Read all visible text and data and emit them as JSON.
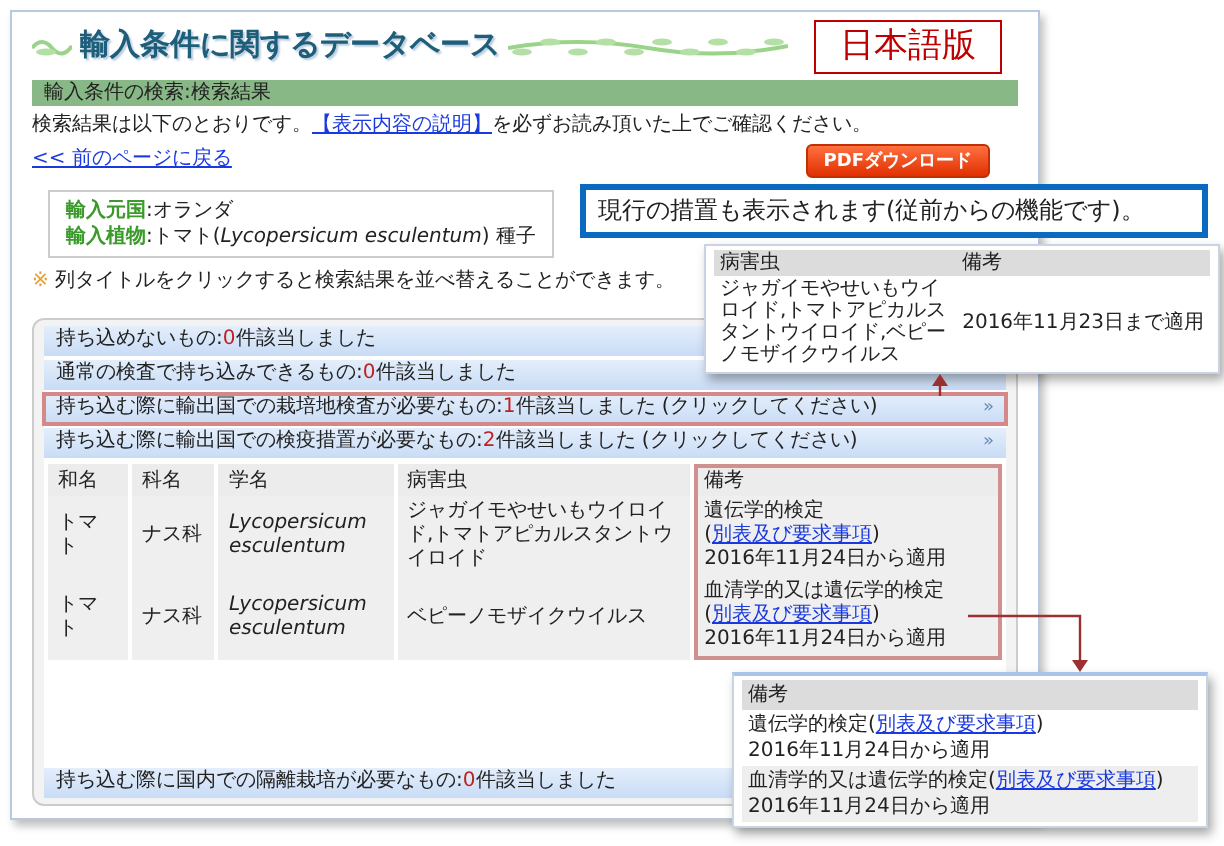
{
  "header": {
    "title": "輸入条件に関するデータベース",
    "badge": "日本語版"
  },
  "breadcrumb": "輸入条件の検索:検索結果",
  "intro": {
    "before": "検索結果は以下のとおりです。",
    "link": "【表示内容の説明】",
    "after": "を必ずお読み頂いた上でご確認ください。"
  },
  "back_link": "<< 前のページに戻る",
  "pdf_button": "PDFダウンロード",
  "summary": [
    {
      "label": "輸入元国",
      "value": ":オランダ"
    },
    {
      "label": "輸入植物",
      "value": ":トマト(*Lycopersicum esculentum*) 種子"
    }
  ],
  "note": {
    "mark": "※",
    "text": "列タイトルをクリックすると検索結果を並べ替えることができます。"
  },
  "categories": [
    {
      "label": "持ち込めないもの:",
      "count": "0",
      "suffix": "件該当しました",
      "highlighted": false
    },
    {
      "label": "通常の検査で持ち込みできるもの:",
      "count": "0",
      "suffix": "件該当しました",
      "highlighted": false
    },
    {
      "label": "持ち込む際に輸出国での栽培地検査が必要なもの:",
      "count": "1",
      "suffix": "件該当しました (クリックしてください)",
      "highlighted": true,
      "icon": "»"
    },
    {
      "label": "持ち込む際に輸出国での検疫措置が必要なもの:",
      "count": "2",
      "suffix": "件該当しました (クリックしてください)",
      "highlighted": false,
      "icon": "»",
      "table": {
        "columns": [
          {
            "label": "和名",
            "highlighted": false
          },
          {
            "label": "科名",
            "highlighted": false
          },
          {
            "label": "学名",
            "highlighted": false
          },
          {
            "label": "病害虫",
            "highlighted": false
          },
          {
            "label": "備考",
            "highlighted": true
          }
        ],
        "rows": [
          {
            "cells": [
              "トマト",
              "ナス科",
              "*Lycopersicum esculentum*",
              "ジャガイモやせいもウイロイド,トマトアピカルスタントウイロイド"
            ],
            "remarks": [
              {
                "text": "遺伝学的検定(",
                "link": "別表及び要求事項",
                "after": ")"
              },
              {
                "text": "2016年11月24日から適用"
              }
            ]
          },
          {
            "cells": [
              "トマト",
              "ナス科",
              "*Lycopersicum esculentum*",
              "ベピーノモザイクウイルス"
            ],
            "remarks": [
              {
                "text": "血清学的又は遺伝学的検定(",
                "link": "別表及び要求事項",
                "after": ")"
              },
              {
                "text": "2016年11月24日から適用"
              }
            ]
          }
        ]
      }
    },
    {
      "label": "持ち込む際に国内での隔離栽培が必要なもの:",
      "count": "0",
      "suffix": "件該当しました",
      "highlighted": false
    }
  ],
  "callout_current": {
    "text": "現行の措置も表示されます(従前からの機能です)。",
    "columns": [
      "病害虫",
      "備考"
    ],
    "row": [
      "ジャガイモやせいもウイロイド,トマトアピカルスタントウイロイド,ベピーノモザイクウイルス",
      "2016年11月23日まで適用"
    ]
  },
  "callout_remarks": {
    "header": "備考",
    "entries": [
      {
        "lines": [
          {
            "text": "遺伝学的検定(",
            "link": "別表及び要求事項",
            "after": ")"
          },
          {
            "text": "2016年11月24日から適用"
          }
        ]
      },
      {
        "lines": [
          {
            "text": "血清学的又は遺伝学的検定(",
            "link": "別表及び要求事項",
            "after": ")"
          },
          {
            "text": "2016年11月24日から適用"
          }
        ]
      }
    ]
  }
}
